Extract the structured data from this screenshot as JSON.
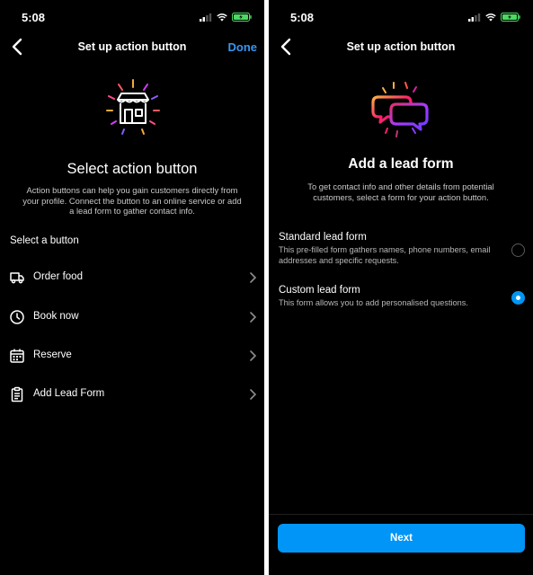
{
  "left": {
    "status": {
      "time": "5:08"
    },
    "header": {
      "title": "Set up action button",
      "done": "Done"
    },
    "heading": "Select action button",
    "description": "Action buttons can help you gain customers directly from your profile. Connect the button to an online service or add a lead form to gather contact info.",
    "section_title": "Select a button",
    "options": [
      {
        "label": "Order food",
        "icon": "truck-icon"
      },
      {
        "label": "Book now",
        "icon": "clock-icon"
      },
      {
        "label": "Reserve",
        "icon": "calendar-icon"
      },
      {
        "label": "Add Lead Form",
        "icon": "clipboard-icon"
      }
    ]
  },
  "right": {
    "status": {
      "time": "5:08"
    },
    "header": {
      "title": "Set up action button"
    },
    "heading": "Add a lead form",
    "description": "To get contact info and other details from potential customers, select a form for your action button.",
    "forms": [
      {
        "title": "Standard lead form",
        "description": "This pre-filled form gathers names, phone numbers, email addresses and specific requests.",
        "selected": false
      },
      {
        "title": "Custom lead form",
        "description": "This form allows you to add personalised questions.",
        "selected": true
      }
    ],
    "next_label": "Next"
  },
  "colors": {
    "accent": "#0095f6",
    "link": "#3797f0",
    "background": "#000000",
    "battery": "#4cd964"
  }
}
